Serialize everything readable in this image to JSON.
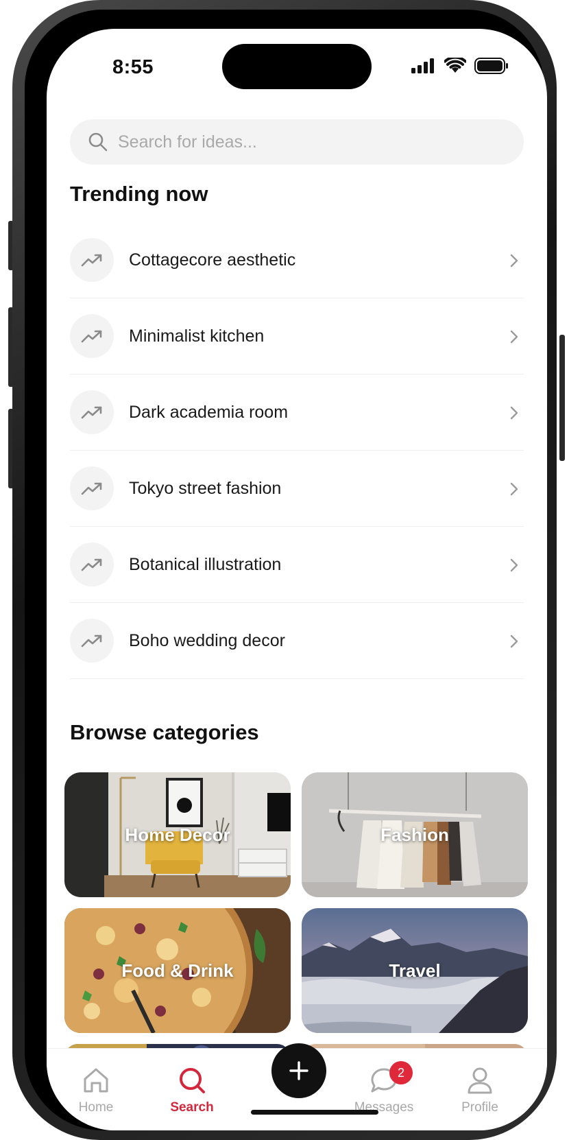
{
  "status_bar": {
    "time": "8:55"
  },
  "search": {
    "placeholder": "Search for ideas..."
  },
  "trending": {
    "heading": "Trending now",
    "items": [
      {
        "label": "Cottagecore aesthetic"
      },
      {
        "label": "Minimalist kitchen"
      },
      {
        "label": "Dark academia room"
      },
      {
        "label": "Tokyo street fashion"
      },
      {
        "label": "Botanical illustration"
      },
      {
        "label": "Boho wedding decor"
      }
    ]
  },
  "categories": {
    "heading": "Browse categories",
    "items": [
      {
        "label": "Home Decor"
      },
      {
        "label": "Fashion"
      },
      {
        "label": "Food & Drink"
      },
      {
        "label": "Travel"
      }
    ]
  },
  "tab_bar": {
    "tabs": [
      {
        "label": "Home",
        "icon": "home-icon"
      },
      {
        "label": "Search",
        "icon": "search-icon",
        "active": true
      },
      {
        "label": "Messages",
        "icon": "chat-bubble-icon",
        "badge": "2"
      },
      {
        "label": "Profile",
        "icon": "person-icon"
      }
    ],
    "create_icon": "plus-icon"
  },
  "colors": {
    "accent": "#d4273c",
    "badge": "#e0283b",
    "text": "#1a1a1a",
    "muted": "#a9a9a9",
    "surface": "#f3f3f3"
  }
}
